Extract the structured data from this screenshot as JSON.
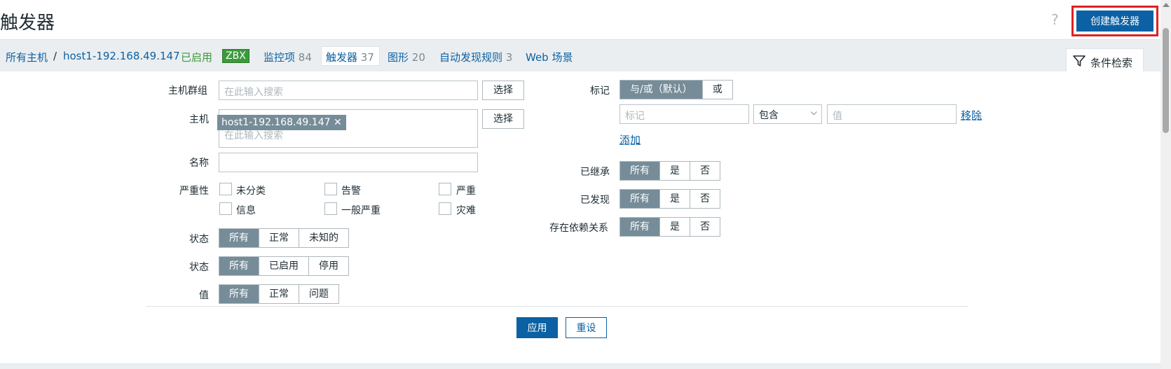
{
  "header": {
    "title": "触发器",
    "help": "?",
    "create_button": "创建触发器"
  },
  "nav": {
    "all_hosts": "所有主机",
    "sep": "/",
    "host": "host1-192.168.49.147",
    "enabled": "已启用",
    "zbx": "ZBX",
    "items_label": "监控项",
    "items_count": "84",
    "triggers_label": "触发器",
    "triggers_count": "37",
    "graphs_label": "图形",
    "graphs_count": "20",
    "discovery_label": "自动发现规则",
    "discovery_count": "3",
    "web_label": "Web 场景",
    "filter_tab": "条件检索"
  },
  "filter": {
    "host_group_label": "主机群组",
    "host_group_placeholder": "在此输入搜索",
    "select_label": "选择",
    "host_label": "主机",
    "host_chip": "host1-192.168.49.147",
    "host_placeholder": "在此输入搜索",
    "name_label": "名称",
    "name_value": "",
    "severity_label": "严重性",
    "severities": [
      "未分类",
      "告警",
      "严重",
      "信息",
      "一般严重",
      "灾难"
    ],
    "state_label": "状态",
    "state_options": [
      "所有",
      "正常",
      "未知的"
    ],
    "status_label": "状态",
    "status_options": [
      "所有",
      "已启用",
      "停用"
    ],
    "value_label": "值",
    "value_options": [
      "所有",
      "正常",
      "问题"
    ],
    "tags_label": "标记",
    "tags_options": [
      "与/或（默认）",
      "或"
    ],
    "tag_placeholder": "标记",
    "tag_operator": "包含",
    "tag_value_placeholder": "值",
    "remove_link": "移除",
    "add_link": "添加",
    "inherited_label": "已继承",
    "discovered_label": "已发现",
    "dependencies_label": "存在依赖关系",
    "yes_no_options": [
      "所有",
      "是",
      "否"
    ],
    "apply_button": "应用",
    "reset_button": "重设"
  }
}
